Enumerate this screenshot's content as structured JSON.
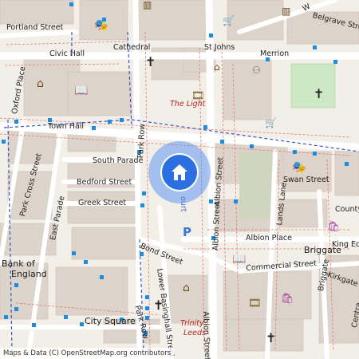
{
  "map": {
    "streets": {
      "portland_street": "Portland Street",
      "civic_hall": "Civic Hall",
      "cathedral": "Cathedral",
      "st_johns": "St Johns",
      "merrion": "Merrion",
      "belgrave_street": "Belgrave Street",
      "oxford_place": "Oxford Place",
      "town_hall": "Town Hall",
      "south_parade": "South Parade",
      "park_row": "Park Row",
      "bedford_street": "Bedford Street",
      "park_cross_street": "Park Cross Street",
      "east_parade": "East Parade",
      "greek_street": "Greek Street",
      "albion_street_1": "Albion Street",
      "albion_street_2": "Albion Street",
      "albion_street_3": "Albion Street",
      "lands_lane": "Lands Lane",
      "swan_street": "Swan Street",
      "county": "County",
      "albion_place": "Albion Place",
      "king_edward": "King Edw",
      "bond_street": "Bond Street",
      "commercial_street": "Commercial Street",
      "briggate": "Briggate",
      "briggate_vertical": "Briggate",
      "kirkgate": "Kirkgate",
      "lower_basinghall_street": "Lower Basinghall Street",
      "city_square": "City Square",
      "park_row_lower": "Park Row",
      "central": "Centra",
      "wade_lane": "W"
    },
    "places": {
      "the_light": "The Light",
      "trinity_leeds_1": "Trinity",
      "trinity_leeds_2": "Leeds",
      "bank_of_england_1": "Bank of",
      "bank_of_england_2": "England",
      "court": "ourt"
    },
    "icons": [
      "theatre-icon",
      "museum-icon",
      "library-icon",
      "church-icon",
      "cinema-icon",
      "shopping-icon",
      "parking-icon",
      "bus-stop-icon",
      "home-icon"
    ],
    "attribution": "Maps & Data (C) OpenStreetMap.org contributors"
  }
}
